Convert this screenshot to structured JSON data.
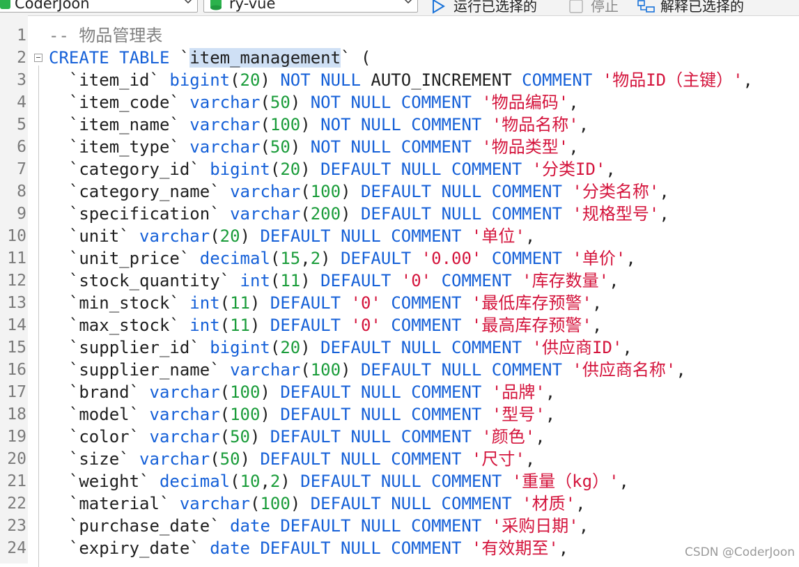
{
  "toolbar": {
    "connection": "CoderJoon",
    "database": "ry-vue",
    "run_selected": "运行已选择的",
    "stop": "停止",
    "explain_selected": "解释已选择的"
  },
  "colors": {
    "keyword": "#1560d8",
    "number": "#1a9c3a",
    "string": "#d4143c",
    "comment": "#808080",
    "selection": "#cfe0f5"
  },
  "editor": {
    "lines": [
      {
        "n": "1",
        "tokens": [
          {
            "t": "-- 物品管理表",
            "c": "cm"
          }
        ]
      },
      {
        "n": "2",
        "tokens": [
          {
            "t": "CREATE TABLE ",
            "c": "kw"
          },
          {
            "t": "`",
            "c": "txt"
          },
          {
            "t": "item_management",
            "c": "txt",
            "sel": true
          },
          {
            "t": "` (",
            "c": "txt"
          }
        ]
      },
      {
        "n": "3",
        "tokens": [
          {
            "t": "  `item_id` ",
            "c": "txt"
          },
          {
            "t": "bigint",
            "c": "ty"
          },
          {
            "t": "(",
            "c": "txt"
          },
          {
            "t": "20",
            "c": "num"
          },
          {
            "t": ") ",
            "c": "txt"
          },
          {
            "t": "NOT NULL ",
            "c": "kw"
          },
          {
            "t": "AUTO_INCREMENT ",
            "c": "txt"
          },
          {
            "t": "COMMENT ",
            "c": "kw"
          },
          {
            "t": "'物品ID（主键）'",
            "c": "str"
          },
          {
            "t": ",",
            "c": "txt"
          }
        ]
      },
      {
        "n": "4",
        "tokens": [
          {
            "t": "  `item_code` ",
            "c": "txt"
          },
          {
            "t": "varchar",
            "c": "ty"
          },
          {
            "t": "(",
            "c": "txt"
          },
          {
            "t": "50",
            "c": "num"
          },
          {
            "t": ") ",
            "c": "txt"
          },
          {
            "t": "NOT NULL COMMENT ",
            "c": "kw"
          },
          {
            "t": "'物品编码'",
            "c": "str"
          },
          {
            "t": ",",
            "c": "txt"
          }
        ]
      },
      {
        "n": "5",
        "tokens": [
          {
            "t": "  `item_name` ",
            "c": "txt"
          },
          {
            "t": "varchar",
            "c": "ty"
          },
          {
            "t": "(",
            "c": "txt"
          },
          {
            "t": "100",
            "c": "num"
          },
          {
            "t": ") ",
            "c": "txt"
          },
          {
            "t": "NOT NULL COMMENT ",
            "c": "kw"
          },
          {
            "t": "'物品名称'",
            "c": "str"
          },
          {
            "t": ",",
            "c": "txt"
          }
        ]
      },
      {
        "n": "6",
        "tokens": [
          {
            "t": "  `item_type` ",
            "c": "txt"
          },
          {
            "t": "varchar",
            "c": "ty"
          },
          {
            "t": "(",
            "c": "txt"
          },
          {
            "t": "50",
            "c": "num"
          },
          {
            "t": ") ",
            "c": "txt"
          },
          {
            "t": "NOT NULL COMMENT ",
            "c": "kw"
          },
          {
            "t": "'物品类型'",
            "c": "str"
          },
          {
            "t": ",",
            "c": "txt"
          }
        ]
      },
      {
        "n": "7",
        "tokens": [
          {
            "t": "  `category_id` ",
            "c": "txt"
          },
          {
            "t": "bigint",
            "c": "ty"
          },
          {
            "t": "(",
            "c": "txt"
          },
          {
            "t": "20",
            "c": "num"
          },
          {
            "t": ") ",
            "c": "txt"
          },
          {
            "t": "DEFAULT NULL COMMENT ",
            "c": "kw"
          },
          {
            "t": "'分类ID'",
            "c": "str"
          },
          {
            "t": ",",
            "c": "txt"
          }
        ]
      },
      {
        "n": "8",
        "tokens": [
          {
            "t": "  `category_name` ",
            "c": "txt"
          },
          {
            "t": "varchar",
            "c": "ty"
          },
          {
            "t": "(",
            "c": "txt"
          },
          {
            "t": "100",
            "c": "num"
          },
          {
            "t": ") ",
            "c": "txt"
          },
          {
            "t": "DEFAULT NULL COMMENT ",
            "c": "kw"
          },
          {
            "t": "'分类名称'",
            "c": "str"
          },
          {
            "t": ",",
            "c": "txt"
          }
        ]
      },
      {
        "n": "9",
        "tokens": [
          {
            "t": "  `specification` ",
            "c": "txt"
          },
          {
            "t": "varchar",
            "c": "ty"
          },
          {
            "t": "(",
            "c": "txt"
          },
          {
            "t": "200",
            "c": "num"
          },
          {
            "t": ") ",
            "c": "txt"
          },
          {
            "t": "DEFAULT NULL COMMENT ",
            "c": "kw"
          },
          {
            "t": "'规格型号'",
            "c": "str"
          },
          {
            "t": ",",
            "c": "txt"
          }
        ]
      },
      {
        "n": "10",
        "tokens": [
          {
            "t": "  `unit` ",
            "c": "txt"
          },
          {
            "t": "varchar",
            "c": "ty"
          },
          {
            "t": "(",
            "c": "txt"
          },
          {
            "t": "20",
            "c": "num"
          },
          {
            "t": ") ",
            "c": "txt"
          },
          {
            "t": "DEFAULT NULL COMMENT ",
            "c": "kw"
          },
          {
            "t": "'单位'",
            "c": "str"
          },
          {
            "t": ",",
            "c": "txt"
          }
        ]
      },
      {
        "n": "11",
        "tokens": [
          {
            "t": "  `unit_price` ",
            "c": "txt"
          },
          {
            "t": "decimal",
            "c": "ty"
          },
          {
            "t": "(",
            "c": "txt"
          },
          {
            "t": "15",
            "c": "num"
          },
          {
            "t": ",",
            "c": "txt"
          },
          {
            "t": "2",
            "c": "num"
          },
          {
            "t": ") ",
            "c": "txt"
          },
          {
            "t": "DEFAULT ",
            "c": "kw"
          },
          {
            "t": "'0.00'",
            "c": "str"
          },
          {
            "t": " ",
            "c": "txt"
          },
          {
            "t": "COMMENT ",
            "c": "kw"
          },
          {
            "t": "'单价'",
            "c": "str"
          },
          {
            "t": ",",
            "c": "txt"
          }
        ]
      },
      {
        "n": "12",
        "tokens": [
          {
            "t": "  `stock_quantity` ",
            "c": "txt"
          },
          {
            "t": "int",
            "c": "ty"
          },
          {
            "t": "(",
            "c": "txt"
          },
          {
            "t": "11",
            "c": "num"
          },
          {
            "t": ") ",
            "c": "txt"
          },
          {
            "t": "DEFAULT ",
            "c": "kw"
          },
          {
            "t": "'0'",
            "c": "str"
          },
          {
            "t": " ",
            "c": "txt"
          },
          {
            "t": "COMMENT ",
            "c": "kw"
          },
          {
            "t": "'库存数量'",
            "c": "str"
          },
          {
            "t": ",",
            "c": "txt"
          }
        ]
      },
      {
        "n": "13",
        "tokens": [
          {
            "t": "  `min_stock` ",
            "c": "txt"
          },
          {
            "t": "int",
            "c": "ty"
          },
          {
            "t": "(",
            "c": "txt"
          },
          {
            "t": "11",
            "c": "num"
          },
          {
            "t": ") ",
            "c": "txt"
          },
          {
            "t": "DEFAULT ",
            "c": "kw"
          },
          {
            "t": "'0'",
            "c": "str"
          },
          {
            "t": " ",
            "c": "txt"
          },
          {
            "t": "COMMENT ",
            "c": "kw"
          },
          {
            "t": "'最低库存预警'",
            "c": "str"
          },
          {
            "t": ",",
            "c": "txt"
          }
        ]
      },
      {
        "n": "14",
        "tokens": [
          {
            "t": "  `max_stock` ",
            "c": "txt"
          },
          {
            "t": "int",
            "c": "ty"
          },
          {
            "t": "(",
            "c": "txt"
          },
          {
            "t": "11",
            "c": "num"
          },
          {
            "t": ") ",
            "c": "txt"
          },
          {
            "t": "DEFAULT ",
            "c": "kw"
          },
          {
            "t": "'0'",
            "c": "str"
          },
          {
            "t": " ",
            "c": "txt"
          },
          {
            "t": "COMMENT ",
            "c": "kw"
          },
          {
            "t": "'最高库存预警'",
            "c": "str"
          },
          {
            "t": ",",
            "c": "txt"
          }
        ]
      },
      {
        "n": "15",
        "tokens": [
          {
            "t": "  `supplier_id` ",
            "c": "txt"
          },
          {
            "t": "bigint",
            "c": "ty"
          },
          {
            "t": "(",
            "c": "txt"
          },
          {
            "t": "20",
            "c": "num"
          },
          {
            "t": ") ",
            "c": "txt"
          },
          {
            "t": "DEFAULT NULL COMMENT ",
            "c": "kw"
          },
          {
            "t": "'供应商ID'",
            "c": "str"
          },
          {
            "t": ",",
            "c": "txt"
          }
        ]
      },
      {
        "n": "16",
        "tokens": [
          {
            "t": "  `supplier_name` ",
            "c": "txt"
          },
          {
            "t": "varchar",
            "c": "ty"
          },
          {
            "t": "(",
            "c": "txt"
          },
          {
            "t": "100",
            "c": "num"
          },
          {
            "t": ") ",
            "c": "txt"
          },
          {
            "t": "DEFAULT NULL COMMENT ",
            "c": "kw"
          },
          {
            "t": "'供应商名称'",
            "c": "str"
          },
          {
            "t": ",",
            "c": "txt"
          }
        ]
      },
      {
        "n": "17",
        "tokens": [
          {
            "t": "  `brand` ",
            "c": "txt"
          },
          {
            "t": "varchar",
            "c": "ty"
          },
          {
            "t": "(",
            "c": "txt"
          },
          {
            "t": "100",
            "c": "num"
          },
          {
            "t": ") ",
            "c": "txt"
          },
          {
            "t": "DEFAULT NULL COMMENT ",
            "c": "kw"
          },
          {
            "t": "'品牌'",
            "c": "str"
          },
          {
            "t": ",",
            "c": "txt"
          }
        ]
      },
      {
        "n": "18",
        "tokens": [
          {
            "t": "  `model` ",
            "c": "txt"
          },
          {
            "t": "varchar",
            "c": "ty"
          },
          {
            "t": "(",
            "c": "txt"
          },
          {
            "t": "100",
            "c": "num"
          },
          {
            "t": ") ",
            "c": "txt"
          },
          {
            "t": "DEFAULT NULL COMMENT ",
            "c": "kw"
          },
          {
            "t": "'型号'",
            "c": "str"
          },
          {
            "t": ",",
            "c": "txt"
          }
        ]
      },
      {
        "n": "19",
        "tokens": [
          {
            "t": "  `color` ",
            "c": "txt"
          },
          {
            "t": "varchar",
            "c": "ty"
          },
          {
            "t": "(",
            "c": "txt"
          },
          {
            "t": "50",
            "c": "num"
          },
          {
            "t": ") ",
            "c": "txt"
          },
          {
            "t": "DEFAULT NULL COMMENT ",
            "c": "kw"
          },
          {
            "t": "'颜色'",
            "c": "str"
          },
          {
            "t": ",",
            "c": "txt"
          }
        ]
      },
      {
        "n": "20",
        "tokens": [
          {
            "t": "  `size` ",
            "c": "txt"
          },
          {
            "t": "varchar",
            "c": "ty"
          },
          {
            "t": "(",
            "c": "txt"
          },
          {
            "t": "50",
            "c": "num"
          },
          {
            "t": ") ",
            "c": "txt"
          },
          {
            "t": "DEFAULT NULL COMMENT ",
            "c": "kw"
          },
          {
            "t": "'尺寸'",
            "c": "str"
          },
          {
            "t": ",",
            "c": "txt"
          }
        ]
      },
      {
        "n": "21",
        "tokens": [
          {
            "t": "  `weight` ",
            "c": "txt"
          },
          {
            "t": "decimal",
            "c": "ty"
          },
          {
            "t": "(",
            "c": "txt"
          },
          {
            "t": "10",
            "c": "num"
          },
          {
            "t": ",",
            "c": "txt"
          },
          {
            "t": "2",
            "c": "num"
          },
          {
            "t": ") ",
            "c": "txt"
          },
          {
            "t": "DEFAULT NULL COMMENT ",
            "c": "kw"
          },
          {
            "t": "'重量（kg）'",
            "c": "str"
          },
          {
            "t": ",",
            "c": "txt"
          }
        ]
      },
      {
        "n": "22",
        "tokens": [
          {
            "t": "  `material` ",
            "c": "txt"
          },
          {
            "t": "varchar",
            "c": "ty"
          },
          {
            "t": "(",
            "c": "txt"
          },
          {
            "t": "100",
            "c": "num"
          },
          {
            "t": ") ",
            "c": "txt"
          },
          {
            "t": "DEFAULT NULL COMMENT ",
            "c": "kw"
          },
          {
            "t": "'材质'",
            "c": "str"
          },
          {
            "t": ",",
            "c": "txt"
          }
        ]
      },
      {
        "n": "23",
        "tokens": [
          {
            "t": "  `purchase_date` ",
            "c": "txt"
          },
          {
            "t": "date ",
            "c": "ty"
          },
          {
            "t": "DEFAULT NULL COMMENT ",
            "c": "kw"
          },
          {
            "t": "'采购日期'",
            "c": "str"
          },
          {
            "t": ",",
            "c": "txt"
          }
        ]
      },
      {
        "n": "24",
        "tokens": [
          {
            "t": "  `expiry_date` ",
            "c": "txt"
          },
          {
            "t": "date ",
            "c": "ty"
          },
          {
            "t": "DEFAULT NULL COMMENT ",
            "c": "kw"
          },
          {
            "t": "'有效期至'",
            "c": "str"
          },
          {
            "t": ",",
            "c": "txt"
          }
        ]
      }
    ]
  },
  "watermark": "CSDN @CoderJoon"
}
